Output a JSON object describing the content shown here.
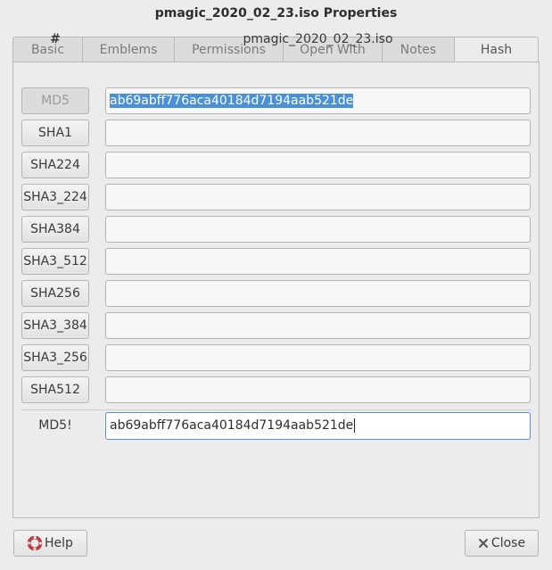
{
  "window": {
    "title": "pmagic_2020_02_23.iso Properties"
  },
  "tabs": [
    {
      "label": "Basic"
    },
    {
      "label": "Emblems"
    },
    {
      "label": "Permissions"
    },
    {
      "label": "Open With"
    },
    {
      "label": "Notes"
    },
    {
      "label": "Hash"
    }
  ],
  "active_tab": "Hash",
  "hash_table": {
    "col_header": "#",
    "file_header": "pmagic_2020_02_23.iso",
    "rows": [
      {
        "algorithm": "MD5",
        "value": "ab69abff776aca40184d7194aab521de"
      },
      {
        "algorithm": "SHA1",
        "value": ""
      },
      {
        "algorithm": "SHA224",
        "value": ""
      },
      {
        "algorithm": "SHA3_224",
        "value": ""
      },
      {
        "algorithm": "SHA384",
        "value": ""
      },
      {
        "algorithm": "SHA3_512",
        "value": ""
      },
      {
        "algorithm": "SHA256",
        "value": ""
      },
      {
        "algorithm": "SHA3_384",
        "value": ""
      },
      {
        "algorithm": "SHA3_256",
        "value": ""
      },
      {
        "algorithm": "SHA512",
        "value": ""
      }
    ]
  },
  "verify": {
    "label": "MD5!",
    "value": "ab69abff776aca40184d7194aab521de"
  },
  "buttons": {
    "help": "Help",
    "close": "Close"
  },
  "colors": {
    "selection": "#4a90d9",
    "focus_border": "#5b8fc9",
    "help_icon": "#d23b3b"
  }
}
